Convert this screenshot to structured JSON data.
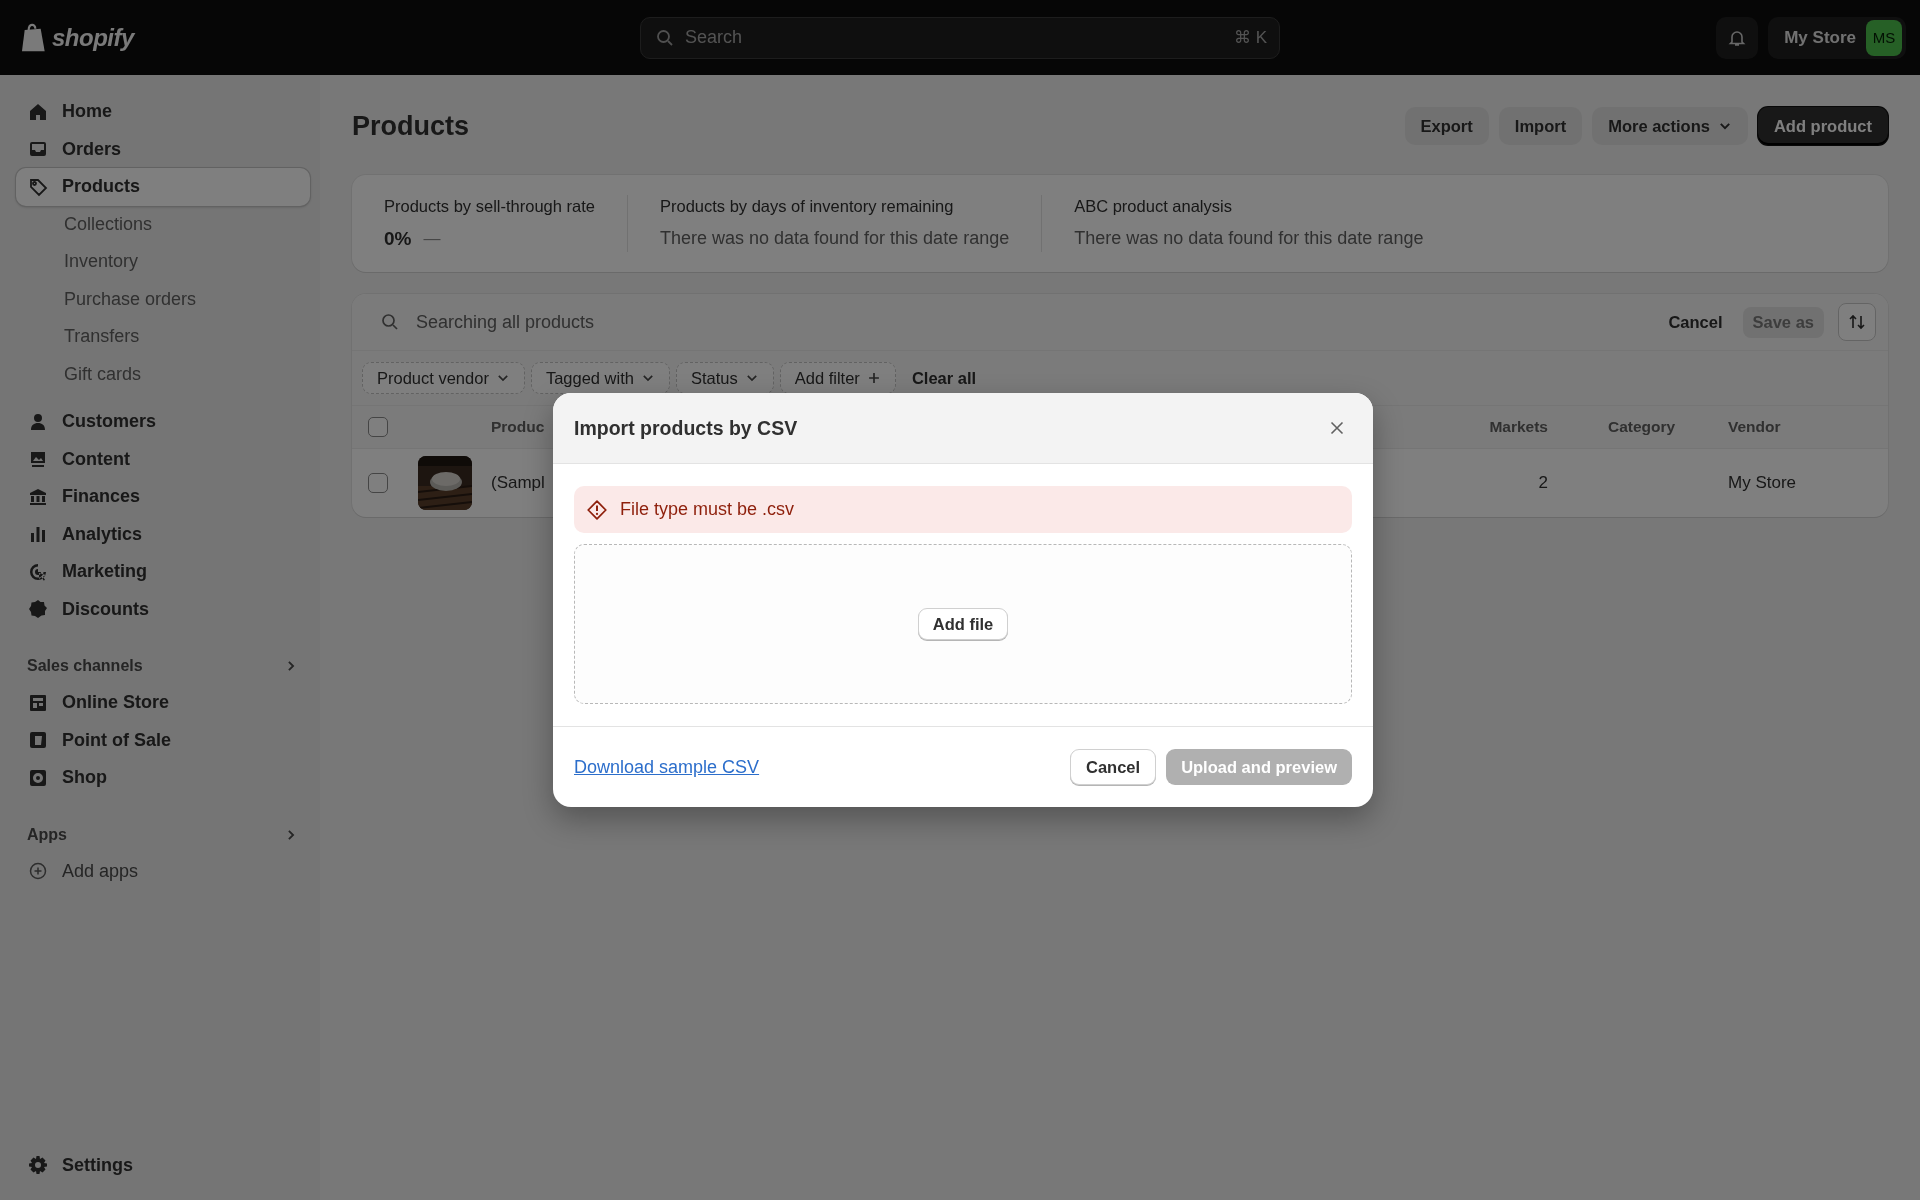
{
  "topbar": {
    "logo": "shopify",
    "search": {
      "placeholder": "Search",
      "shortcut": "⌘ K"
    },
    "store": "My Store",
    "avatar": "MS"
  },
  "sidebar": {
    "items": [
      {
        "label": "Home",
        "selected": false
      },
      {
        "label": "Orders",
        "selected": false
      },
      {
        "label": "Products",
        "selected": true,
        "children": [
          {
            "label": "Collections",
            "selected": false
          },
          {
            "label": "Inventory",
            "selected": false
          },
          {
            "label": "Purchase orders",
            "selected": false
          },
          {
            "label": "Transfers",
            "selected": false
          },
          {
            "label": "Gift cards",
            "selected": false
          }
        ]
      },
      {
        "label": "Customers",
        "selected": false
      },
      {
        "label": "Content",
        "selected": false
      },
      {
        "label": "Finances",
        "selected": false
      },
      {
        "label": "Analytics",
        "selected": false
      },
      {
        "label": "Marketing",
        "selected": false
      },
      {
        "label": "Discounts",
        "selected": false
      }
    ],
    "sections": [
      {
        "title": "Sales channels",
        "items": [
          {
            "label": "Online Store",
            "selected": false
          },
          {
            "label": "Point of Sale",
            "selected": false
          },
          {
            "label": "Shop",
            "selected": false
          }
        ]
      },
      {
        "title": "Apps",
        "items": [
          {
            "label": "Add apps",
            "selected": false
          }
        ]
      }
    ],
    "settings": "Settings"
  },
  "page": {
    "title": "Products",
    "actions": [
      {
        "label": "Export",
        "kind": "secondary"
      },
      {
        "label": "Import",
        "kind": "secondary"
      },
      {
        "label": "More actions",
        "kind": "menu"
      },
      {
        "label": "Add product",
        "kind": "primary"
      }
    ]
  },
  "metrics": [
    {
      "title": "Products by sell-through rate",
      "value": "0%",
      "trend": "—"
    },
    {
      "title": "Products by days of inventory remaining",
      "note": "There was no data found for this date range"
    },
    {
      "title": "ABC product analysis",
      "note": "There was no data found for this date range"
    }
  ],
  "table": {
    "search": {
      "placeholder": "Searching all products"
    },
    "cancel": "Cancel",
    "save_as": {
      "label": "Save as",
      "disabled": true
    },
    "filters": [
      {
        "label": "Product vendor",
        "kind": "dropdown"
      },
      {
        "label": "Tagged with",
        "kind": "dropdown"
      },
      {
        "label": "Status",
        "kind": "dropdown"
      },
      {
        "label": "Add filter",
        "kind": "add"
      }
    ],
    "clear": "Clear all",
    "header_checked": false,
    "columns": [
      "Produc",
      "Markets",
      "Category",
      "Vendor"
    ],
    "rows": [
      {
        "checked": false,
        "product": "(Sampl",
        "markets": "2",
        "vendor": "My Store"
      }
    ]
  },
  "modal": {
    "title": "Import products by CSV",
    "error": "File type must be .csv",
    "add_file": "Add file",
    "link": "Download sample CSV",
    "cancel": "Cancel",
    "submit": {
      "label": "Upload and preview",
      "disabled": true
    }
  }
}
